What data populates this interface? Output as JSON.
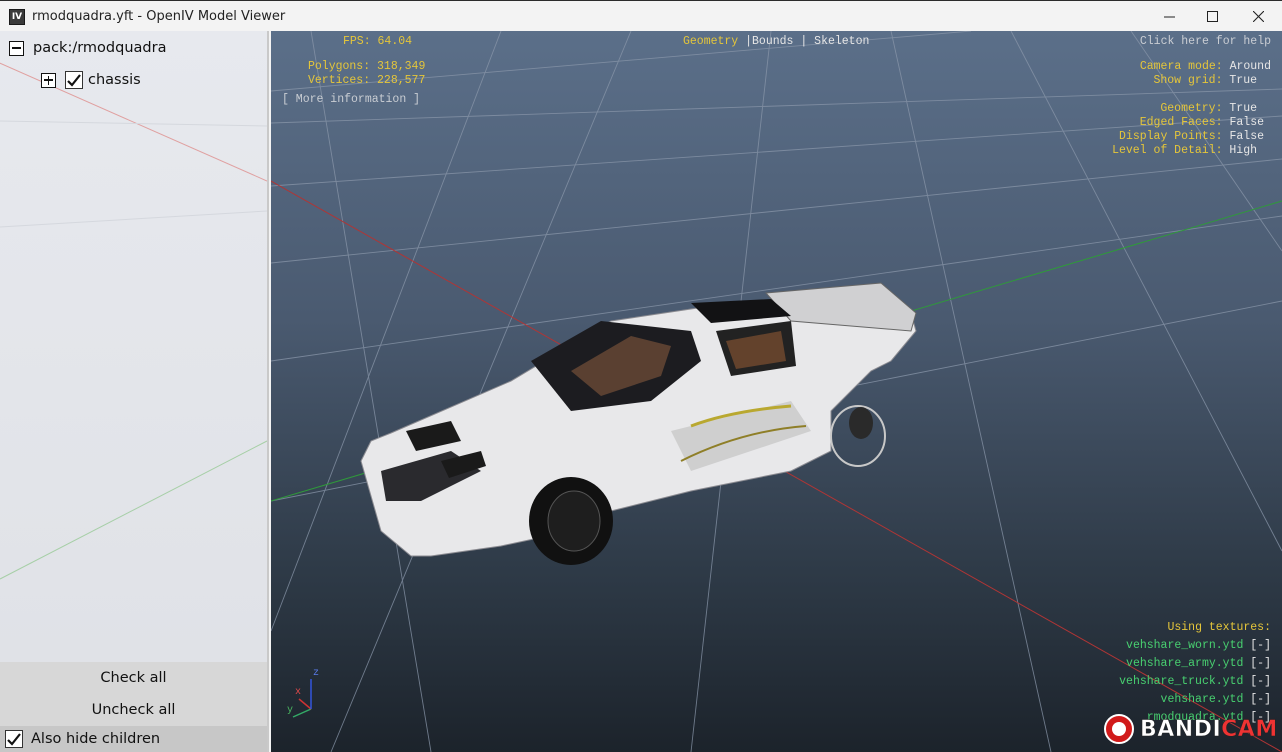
{
  "window": {
    "title": "rmodquadra.yft - OpenIV Model Viewer",
    "app_icon_text": "IV"
  },
  "tree": {
    "root_label": "pack:/rmodquadra",
    "root_expanded": true,
    "children": [
      {
        "label": "chassis",
        "checked": true,
        "expanded": false
      }
    ]
  },
  "buttons": {
    "check_all": "Check all",
    "uncheck_all": "Uncheck all",
    "also_hide_children": "Also hide children"
  },
  "also_hide_children_checked": true,
  "stats": {
    "fps_label": "FPS:",
    "fps_value": "64.04",
    "polygons_label": "Polygons:",
    "polygons_value": "318,349",
    "vertices_label": "Vertices:",
    "vertices_value": "228,577",
    "more_info": "[ More information ]"
  },
  "mode_tabs": {
    "geometry": "Geometry",
    "sep1": "|",
    "bounds": "Bounds",
    "sep2": "|",
    "skeleton": "Skeleton",
    "active": "geometry"
  },
  "help_link": "Click here for help",
  "settings": {
    "camera_mode_label": "Camera mode:",
    "camera_mode_value": "Around",
    "show_grid_label": "Show grid:",
    "show_grid_value": "True",
    "geometry_label": "Geometry:",
    "geometry_value": "True",
    "edged_faces_label": "Edged Faces:",
    "edged_faces_value": "False",
    "display_points_label": "Display Points:",
    "display_points_value": "False",
    "lod_label": "Level of Detail:",
    "lod_value": "High"
  },
  "textures": {
    "heading": "Using textures:",
    "items": [
      {
        "name": "vehshare_worn.ytd",
        "action": "[-]"
      },
      {
        "name": "vehshare_army.ytd",
        "action": "[-]"
      },
      {
        "name": "vehshare_truck.ytd",
        "action": "[-]"
      },
      {
        "name": "vehshare.ytd",
        "action": "[-]"
      },
      {
        "name": "rmodquadra.ytd",
        "action": "[-]"
      }
    ]
  },
  "axes": {
    "x": "x",
    "y": "y",
    "z": "z"
  },
  "watermark": {
    "part1": "BANDI",
    "part2": "CAM"
  },
  "colors": {
    "hud_yellow": "#e5c63a",
    "hud_white": "#e6e6e6",
    "texture_green": "#48d070",
    "axis_x": "#d03030",
    "axis_y": "#30b030",
    "axis_z": "#3050e0"
  }
}
